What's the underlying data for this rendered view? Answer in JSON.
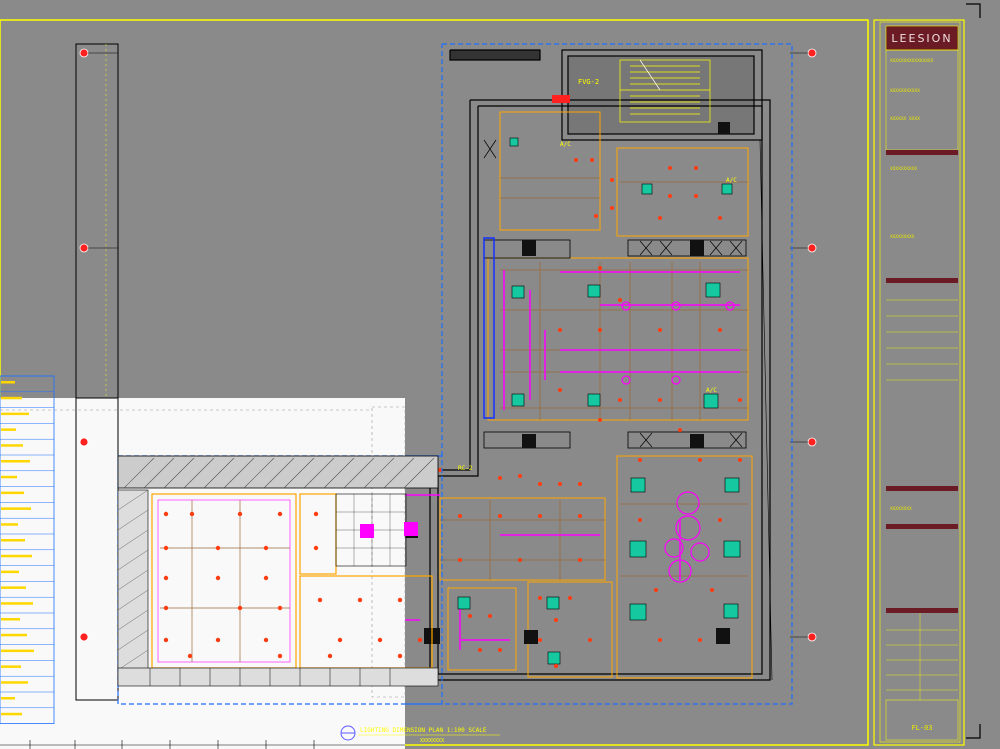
{
  "titleblock": {
    "logo": "LEESION",
    "sheet_no": "FL-03",
    "room_code": "FVG-2",
    "blocks": [
      "XXXXXXXXXXXXXXXX",
      "XXXXXXXXXXX",
      "XXXXXX XXXX",
      "XXXXXXXXXX",
      "XXXXXXXXX",
      "XXXXXXXX"
    ]
  },
  "drawing": {
    "caption": "LIGHTING DIMENSION PLAN 1:100 SCALE",
    "subcaption": "XXXXXXXX",
    "label_ac": "A/C",
    "label_rc": "RC-2"
  },
  "colors": {
    "background": "#8a8a8a",
    "border": "#ffff00",
    "viewport": "#1e6fff",
    "lights": "#ff3b10",
    "magenta": "#ff00ff",
    "teal": "#15c8a0",
    "orange": "#ffa500",
    "titleblock_header": "#6b1b24"
  },
  "legend_rows": 22
}
